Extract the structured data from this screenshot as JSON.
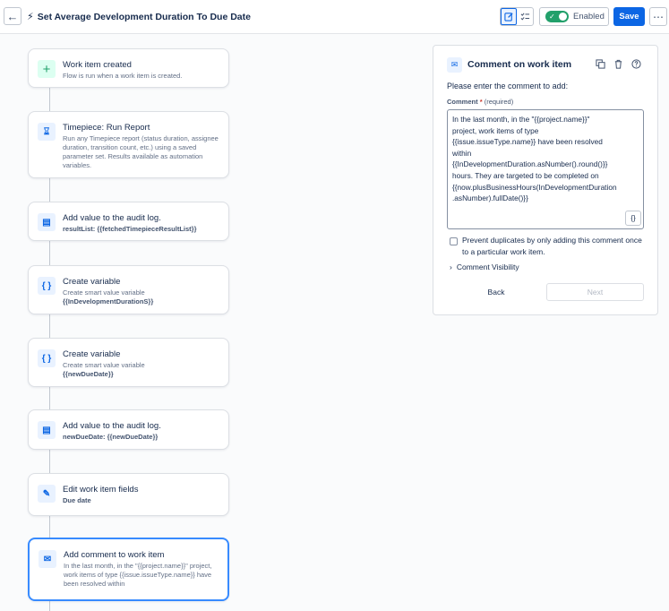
{
  "header": {
    "title": "Set Average Development Duration To Due Date",
    "enabled_label": "Enabled",
    "save_label": "Save"
  },
  "flow": {
    "cards": [
      {
        "icon": "plus-icon",
        "title": "Work item created",
        "desc": "Flow is run when a work item is created."
      },
      {
        "icon": "hourglass-icon",
        "title": "Timepiece: Run Report",
        "desc": "Run any Timepiece report (status duration, assignee duration, transition count, etc.) using a saved parameter set. Results available as automation variables."
      },
      {
        "icon": "log-icon",
        "title": "Add value to the audit log.",
        "desc_prefix": "resultList: ",
        "desc_strong": "{{fetchedTimepieceResultList}}"
      },
      {
        "icon": "braces-icon",
        "title": "Create variable",
        "desc": "Create smart value variable",
        "desc_strong": "{{InDevelopmentDurationS}}"
      },
      {
        "icon": "braces-icon",
        "title": "Create variable",
        "desc": "Create smart value variable",
        "desc_strong": "{{newDueDate}}"
      },
      {
        "icon": "log-icon",
        "title": "Add value to the audit log.",
        "desc_prefix": "newDueDate: ",
        "desc_strong": "{{newDueDate}}"
      },
      {
        "icon": "edit-icon",
        "title": "Edit work item fields",
        "desc_strong": "Due date"
      },
      {
        "icon": "comment-icon",
        "title": "Add comment to work item",
        "desc": "In the last month, in the \"{{project.name}}\" project, work items of type {{issue.issueType.name}} have been resolved within"
      }
    ]
  },
  "panel": {
    "title": "Comment on work item",
    "prompt": "Please enter the comment to add:",
    "field_label": "Comment",
    "required_mark": "*",
    "required_text": "(required)",
    "comment_value": "In the last month, in the \"{{project.name}}\"\nproject, work items of type\n{{issue.issueType.name}} have been resolved\nwithin\n{{InDevelopmentDuration.asNumber().round()}}\nhours. They are targeted to be completed on\n{{now.plusBusinessHours(InDevelopmentDuration\n.asNumber).fullDate()}}",
    "braces_label": "{}",
    "prevent_duplicates_label": "Prevent duplicates by only adding this comment once to a particular work item.",
    "visibility_label": "Comment Visibility",
    "back_label": "Back",
    "next_label": "Next"
  },
  "colors": {
    "accent": "#0c66e4",
    "enabled_green": "#22a06b",
    "selected_border": "#388bff"
  }
}
